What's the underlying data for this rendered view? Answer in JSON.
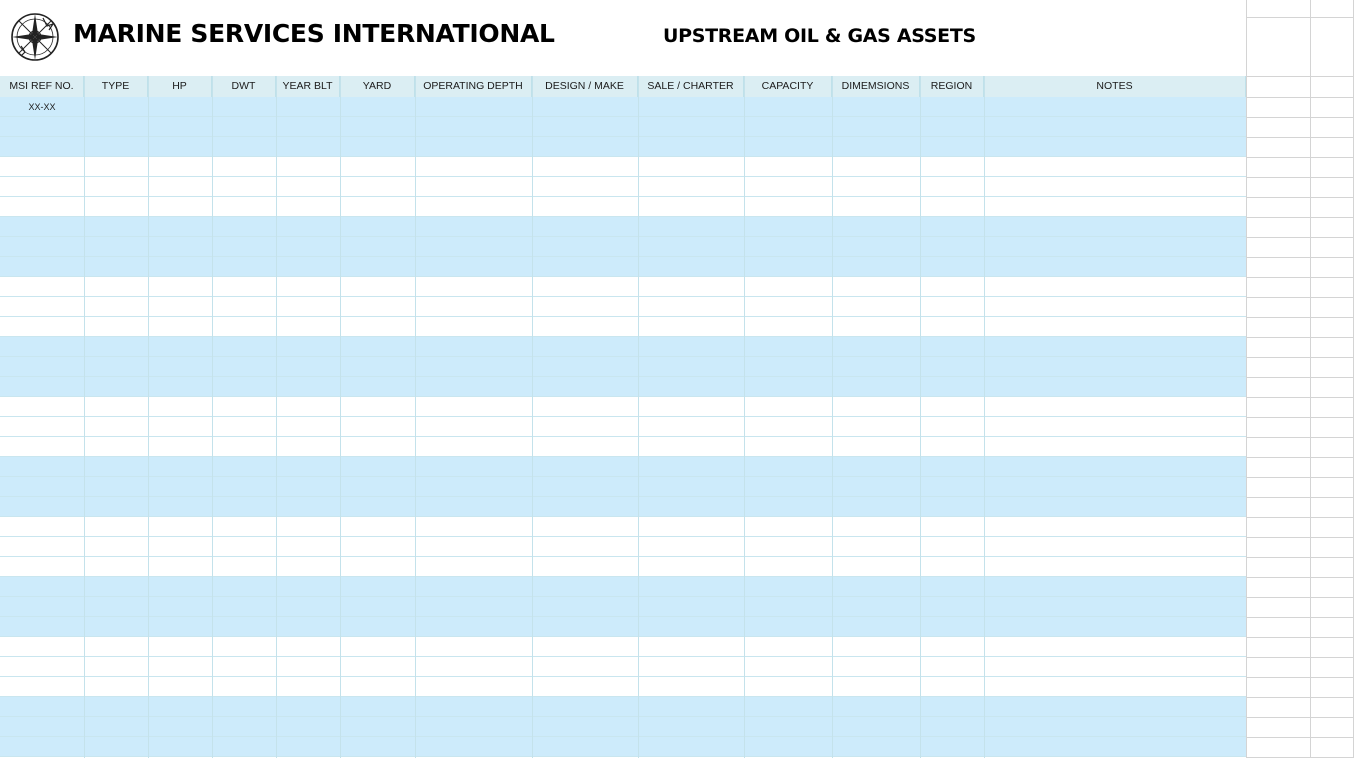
{
  "header": {
    "company_name": "MARINE SERVICES INTERNATIONAL",
    "doc_title": "UPSTREAM OIL & GAS ASSETS",
    "logo_icon": "compass-rose-icon"
  },
  "table": {
    "columns": [
      "MSI REF NO.",
      "TYPE",
      "HP",
      "DWT",
      "YEAR BLT",
      "YARD",
      "OPERATING DEPTH",
      "DESIGN / MAKE",
      "SALE / CHARTER",
      "CAPACITY",
      "DIMEMSIONS",
      "REGION",
      "NOTES"
    ],
    "first_ref_placeholder": "XX-XX",
    "band_pattern": [
      "blue",
      "white"
    ],
    "rows_per_band": 3
  },
  "colors": {
    "blue_band": "#cdebfb",
    "header_band": "#dbeef3",
    "gridline": "#c4e2eb"
  }
}
